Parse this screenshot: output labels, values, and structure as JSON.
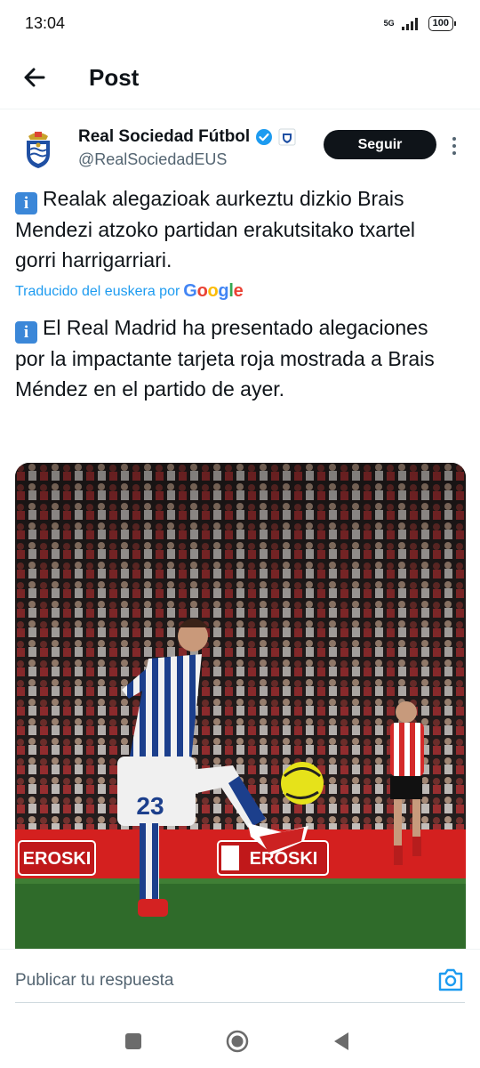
{
  "status_bar": {
    "time": "13:04",
    "network": "5G",
    "battery": "100"
  },
  "header": {
    "title": "Post"
  },
  "author": {
    "name": "Real Sociedad Fútbol",
    "handle": "@RealSociedadEUS",
    "verified": true,
    "follow_label": "Seguir"
  },
  "tweet": {
    "info_glyph": "i",
    "original_text": "Realak alegazioak aurkeztu dizkio Brais Mendezi atzoko partidan erakutsitako txartel gorri harrigarriari.",
    "translation_label": "Traducido del euskera por",
    "translation_provider": "Google",
    "translated_text": "El Real Madrid ha presentado alegaciones por la impactante tarjeta roja mostrada a Brais Méndez en el partido de ayer."
  },
  "media": {
    "player_number": "23",
    "board_text_1": "EROSKI",
    "board_text_2": "EROSKI"
  },
  "reply": {
    "placeholder": "Publicar tu respuesta"
  },
  "colors": {
    "accent": "#1d9bf0",
    "text": "#0f1419",
    "muted": "#536471"
  },
  "icons": [
    "back-arrow-icon",
    "verified-badge-icon",
    "affiliate-badge-icon",
    "more-options-icon",
    "info-icon",
    "camera-icon",
    "recents-icon",
    "home-icon",
    "back-icon"
  ]
}
